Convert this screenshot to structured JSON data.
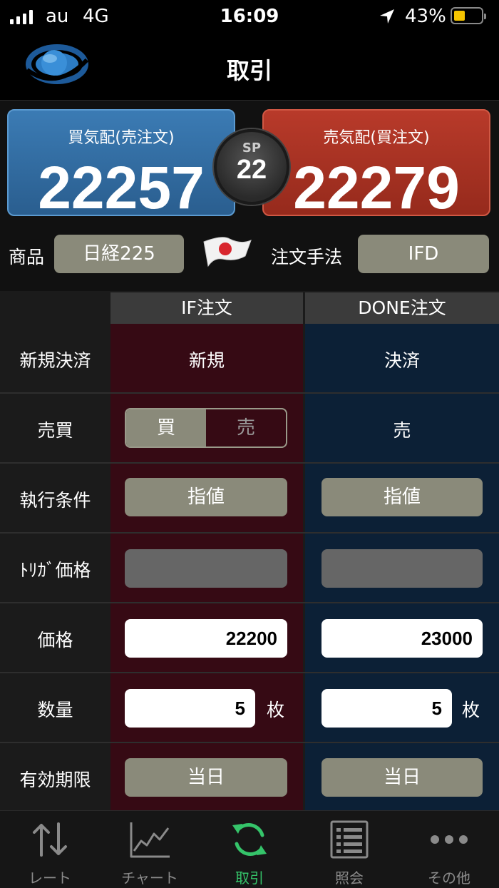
{
  "status": {
    "carrier": "au",
    "network": "4G",
    "time": "16:09",
    "battery_pct": "43%",
    "battery_level": 0.43,
    "signal_bars": 4
  },
  "header": {
    "title": "取引",
    "logo_icon": "app-logo-icon"
  },
  "quotes": {
    "bid_label": "買気配(売注文)",
    "bid_value": "22257",
    "ask_label": "売気配(買注文)",
    "ask_value": "22279",
    "spread_label": "SP",
    "spread_value": "22",
    "bid_color": "#2f6ea6",
    "ask_color": "#a8301f"
  },
  "product": {
    "label": "商品",
    "value": "日経225",
    "flag_icon": "japan-flag-icon"
  },
  "method": {
    "label": "注文手法",
    "value": "IFD"
  },
  "order": {
    "col_if": "IF注文",
    "col_done": "DONE注文",
    "rows": {
      "new_close": {
        "label": "新規決済",
        "if": "新規",
        "done": "決済"
      },
      "side": {
        "label": "売買",
        "if_buy": "買",
        "if_sell": "売",
        "if_selected": "買",
        "done": "売"
      },
      "exec": {
        "label": "執行条件",
        "if": "指値",
        "done": "指値"
      },
      "trigger": {
        "label": "ﾄﾘｶﾞ価格",
        "if": "",
        "done": ""
      },
      "price": {
        "label": "価格",
        "if": "22200",
        "done": "23000"
      },
      "qty": {
        "label": "数量",
        "if": "5",
        "done": "5",
        "unit": "枚"
      },
      "expiry": {
        "label": "有効期限",
        "if": "当日",
        "done": "当日"
      }
    }
  },
  "tabs": [
    {
      "label": "レート",
      "icon": "rate-arrows-icon",
      "active": false
    },
    {
      "label": "チャート",
      "icon": "chart-icon",
      "active": false
    },
    {
      "label": "取引",
      "icon": "trade-refresh-icon",
      "active": true
    },
    {
      "label": "照会",
      "icon": "list-icon",
      "active": false
    },
    {
      "label": "その他",
      "icon": "more-icon",
      "active": false
    }
  ],
  "colors": {
    "active_tab": "#35c46a",
    "if_column": "#360a14",
    "done_column": "#0c2036"
  }
}
